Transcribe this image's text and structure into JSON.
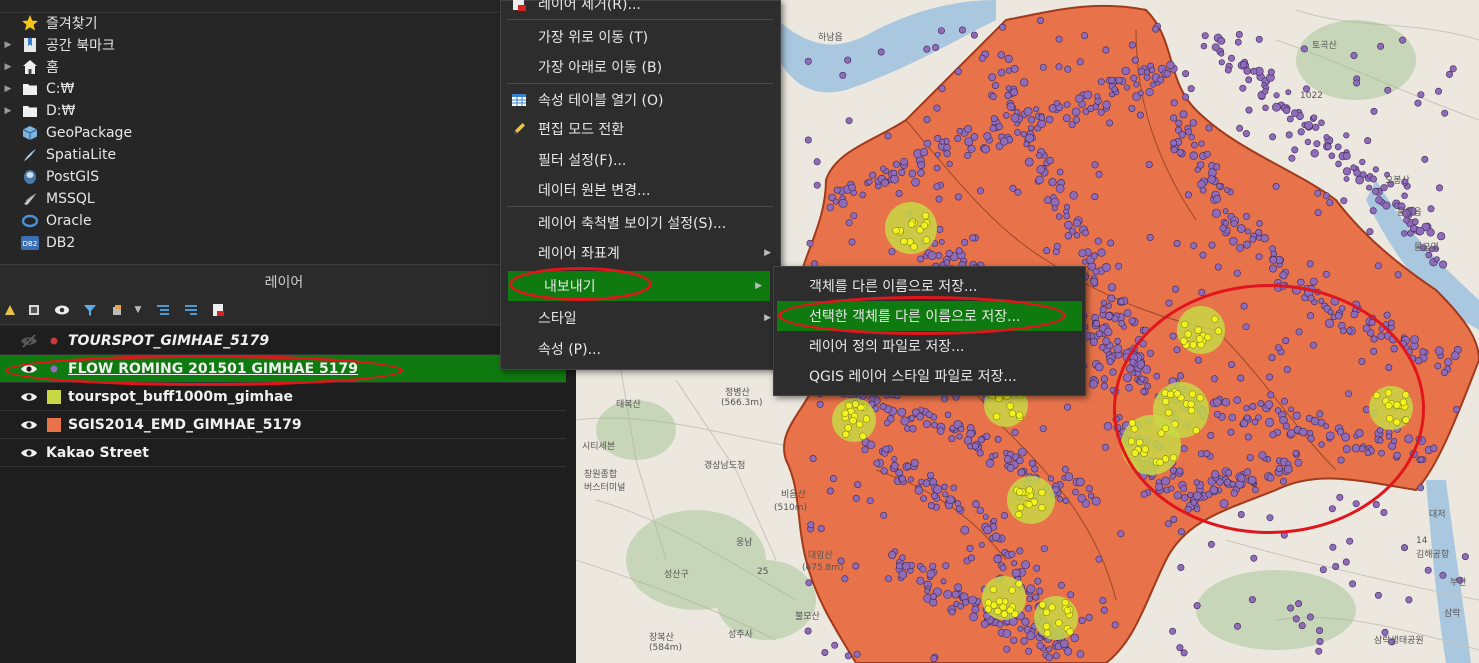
{
  "browser": {
    "items": [
      {
        "label": "즐겨찾기",
        "icon": "star-icon",
        "expandable": false
      },
      {
        "label": "공간 북마크",
        "icon": "bookmark-icon",
        "expandable": true
      },
      {
        "label": "홈",
        "icon": "home-icon",
        "expandable": true
      },
      {
        "label": "C:₩",
        "icon": "folder-icon",
        "expandable": true
      },
      {
        "label": "D:₩",
        "icon": "folder-icon",
        "expandable": true
      },
      {
        "label": "GeoPackage",
        "icon": "geopackage-icon",
        "expandable": false
      },
      {
        "label": "SpatiaLite",
        "icon": "spatialite-icon",
        "expandable": false
      },
      {
        "label": "PostGIS",
        "icon": "postgis-icon",
        "expandable": false
      },
      {
        "label": "MSSQL",
        "icon": "mssql-icon",
        "expandable": false
      },
      {
        "label": "Oracle",
        "icon": "oracle-icon",
        "expandable": false
      },
      {
        "label": "DB2",
        "icon": "db2-icon",
        "expandable": false
      }
    ]
  },
  "layers_panel": {
    "title": "레이어",
    "layers": [
      {
        "name": "TOURSPOT_GIMHAE_5179",
        "visible": false,
        "symbol_color": "#c9393b",
        "symbol": "point",
        "italic": true,
        "selected": false
      },
      {
        "name": "FLOW ROMING 201501 GIMHAE 5179",
        "visible": true,
        "symbol_color": "#8f6bb8",
        "symbol": "point",
        "italic": false,
        "selected": true
      },
      {
        "name": "tourspot_buff1000m_gimhae",
        "visible": true,
        "symbol_color": "#c8d845",
        "symbol": "fill",
        "italic": false,
        "selected": false
      },
      {
        "name": "SGIS2014_EMD_GIMHAE_5179",
        "visible": true,
        "symbol_color": "#e8734a",
        "symbol": "fill",
        "italic": false,
        "selected": false
      },
      {
        "name": "Kakao Street",
        "visible": true,
        "symbol_color": "",
        "symbol": "none",
        "italic": false,
        "selected": false
      }
    ]
  },
  "context_menu": {
    "items": [
      {
        "label": "레이어 제거(R)...",
        "icon": "remove-layer-icon",
        "submenu": false
      },
      {
        "label": "가장 위로 이동 (T)",
        "icon": "",
        "submenu": false
      },
      {
        "label": "가장 아래로 이동 (B)",
        "icon": "",
        "submenu": false
      },
      {
        "label": "속성 테이블 열기 (O)",
        "icon": "table-icon",
        "submenu": false
      },
      {
        "label": "편집 모드 전환",
        "icon": "pencil-icon",
        "submenu": false
      },
      {
        "label": "필터 설정(F)...",
        "icon": "",
        "submenu": false
      },
      {
        "label": "데이터 원본 변경...",
        "icon": "",
        "submenu": false
      },
      {
        "label": "레이어 축척별 보이기 설정(S)...",
        "icon": "",
        "submenu": false
      },
      {
        "label": "레이어 좌표계",
        "icon": "",
        "submenu": true
      },
      {
        "label": "내보내기",
        "icon": "",
        "submenu": true,
        "active": true
      },
      {
        "label": "스타일",
        "icon": "",
        "submenu": true
      },
      {
        "label": "속성 (P)...",
        "icon": "",
        "submenu": false
      }
    ]
  },
  "export_submenu": {
    "items": [
      {
        "label": "객체를 다른 이름으로 저장...",
        "active": false
      },
      {
        "label": "선택한 객체를 다른 이름으로 저장...",
        "active": true
      },
      {
        "label": "레이어 정의 파일로 저장...",
        "active": false
      },
      {
        "label": "QGIS 레이어 스타일 파일로 저장...",
        "active": false
      }
    ]
  },
  "map_labels": [
    {
      "text": "하남읍"
    },
    {
      "text": "토곡산"
    },
    {
      "text": "1022"
    },
    {
      "text": "오봉산"
    },
    {
      "text": "물금읍"
    },
    {
      "text": "물금역"
    },
    {
      "text": "정병산"
    },
    {
      "text": "(566.3m)"
    },
    {
      "text": "태복산"
    },
    {
      "text": "시티세븐"
    },
    {
      "text": "창원종합"
    },
    {
      "text": "버스터미널"
    },
    {
      "text": "경상남도청"
    },
    {
      "text": "비음산"
    },
    {
      "text": "(510m)"
    },
    {
      "text": "대암산"
    },
    {
      "text": "(675.8m)"
    },
    {
      "text": "웅남"
    },
    {
      "text": "성산구"
    },
    {
      "text": "25"
    },
    {
      "text": "불모산"
    },
    {
      "text": "장복산"
    },
    {
      "text": "(584m)"
    },
    {
      "text": "성주사"
    },
    {
      "text": "김해공항"
    },
    {
      "text": "삼락생태공원"
    },
    {
      "text": "14"
    },
    {
      "text": "58"
    },
    {
      "text": "부산"
    },
    {
      "text": "대저"
    },
    {
      "text": "삼락"
    }
  ],
  "colors": {
    "highlight": "#0f7a0f",
    "annotation": "#e0161c",
    "region_fill": "#e8734a",
    "point_fill": "#8f6bb8",
    "buffer_fill": "#f2f21e"
  }
}
